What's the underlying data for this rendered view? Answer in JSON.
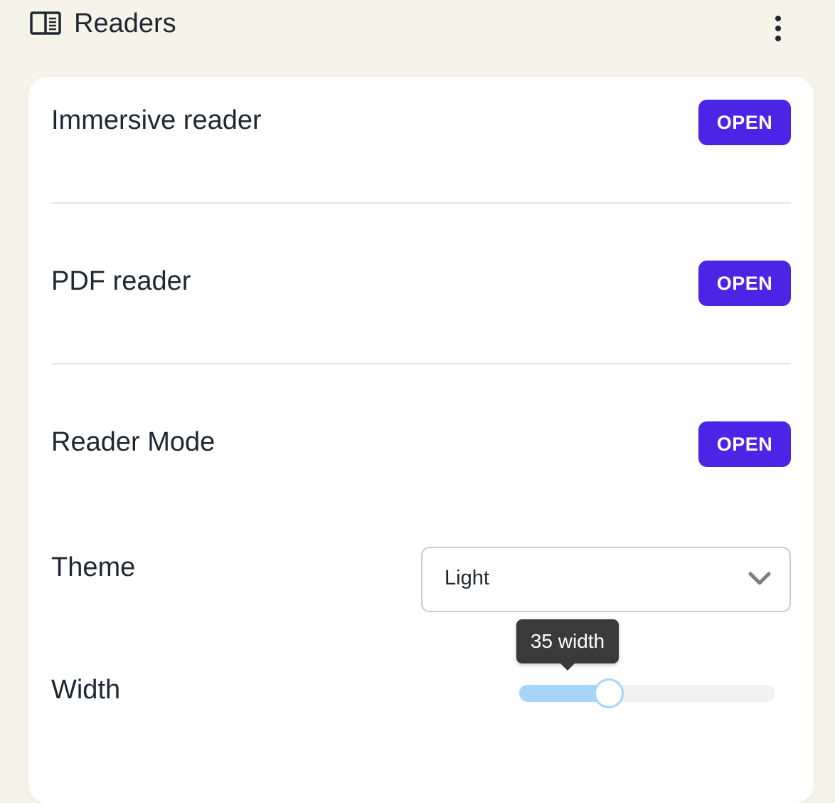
{
  "header": {
    "title": "Readers",
    "icon": "reader-panel-icon",
    "menu_icon": "more-vertical-icon"
  },
  "readers": [
    {
      "label": "Immersive reader",
      "button": "OPEN"
    },
    {
      "label": "PDF reader",
      "button": "OPEN"
    },
    {
      "label": "Reader Mode",
      "button": "OPEN"
    }
  ],
  "theme": {
    "label": "Theme",
    "value": "Light",
    "icon": "chevron-down-icon"
  },
  "width": {
    "label": "Width",
    "value": 35,
    "min": 0,
    "max": 100,
    "tooltip": "35 width"
  },
  "colors": {
    "background": "#f6f4e8",
    "card": "#ffffff",
    "accent": "#4b24e6",
    "slider": "#a8d5f7",
    "tooltip": "#3a3a3a"
  }
}
